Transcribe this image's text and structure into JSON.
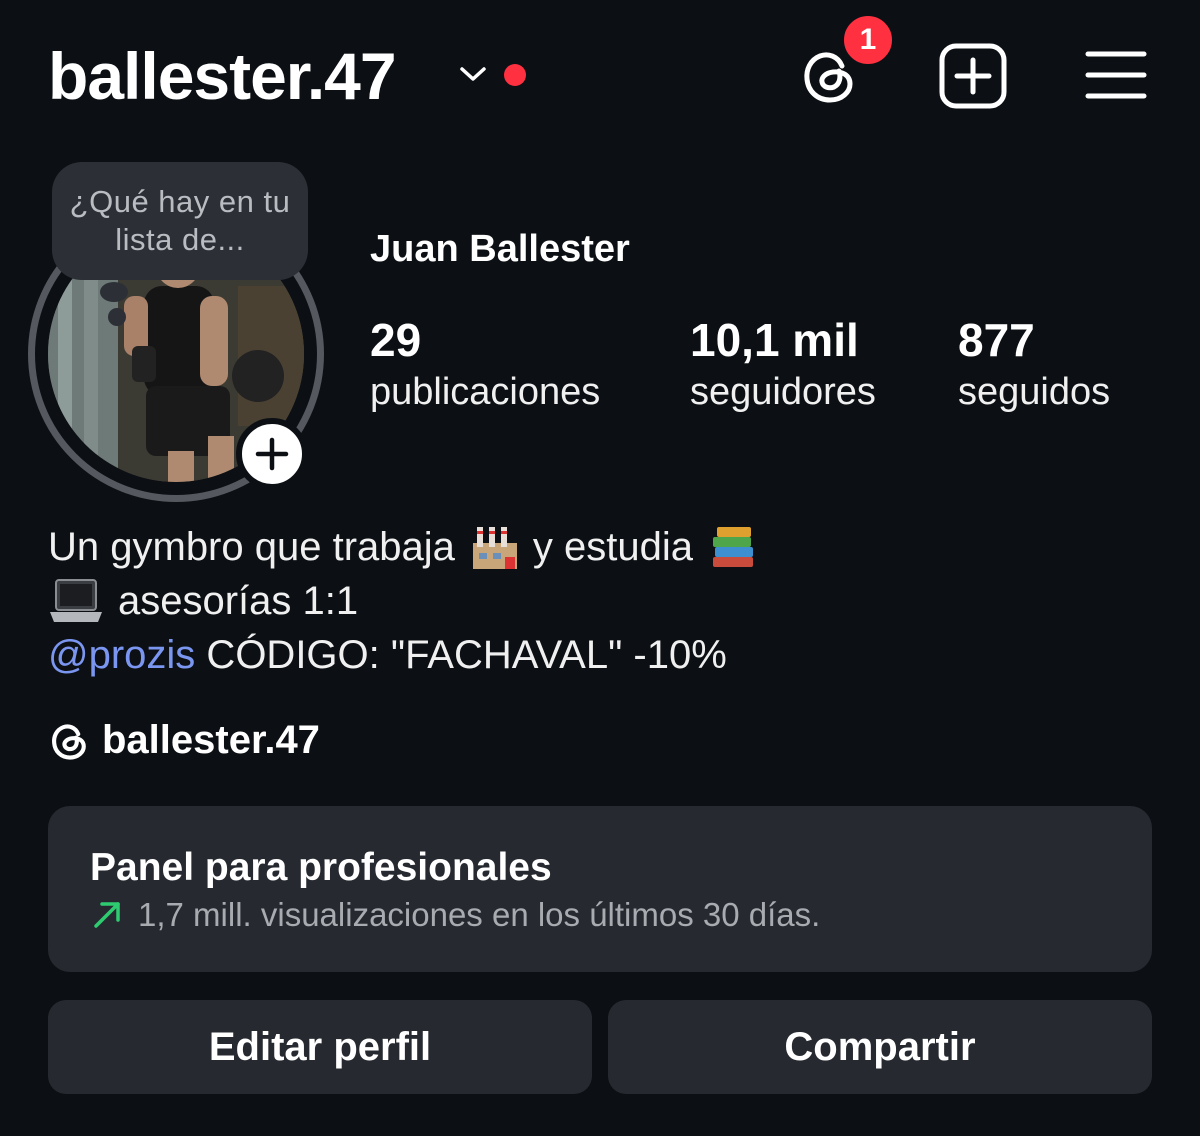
{
  "header": {
    "username": "ballester.47",
    "threads_badge_count": "1"
  },
  "profile": {
    "note": "¿Qué hay en tu lista de...",
    "display_name": "Juan Ballester",
    "stats": [
      {
        "value": "29",
        "label": "publicaciones"
      },
      {
        "value": "10,1 mil",
        "label": "seguidores"
      },
      {
        "value": "877",
        "label": "seguidos"
      }
    ]
  },
  "bio": {
    "line1_a": "Un gymbro que trabaja",
    "line1_b": "y estudia",
    "line2": "asesorías 1:1",
    "mention": "@prozis",
    "line3": " CÓDIGO: \"FACHAVAL\" -10%",
    "threads_handle": "ballester.47"
  },
  "pro_panel": {
    "title": "Panel para profesionales",
    "subtitle": "1,7 mill. visualizaciones en los últimos 30 días."
  },
  "actions": {
    "edit_label": "Editar perfil",
    "share_label": "Compartir"
  },
  "colors": {
    "background": "#0c1014",
    "card": "#262a30",
    "accent_red": "#ff3040",
    "mention_blue": "#7b96f0",
    "trend_green": "#2ecc71"
  }
}
